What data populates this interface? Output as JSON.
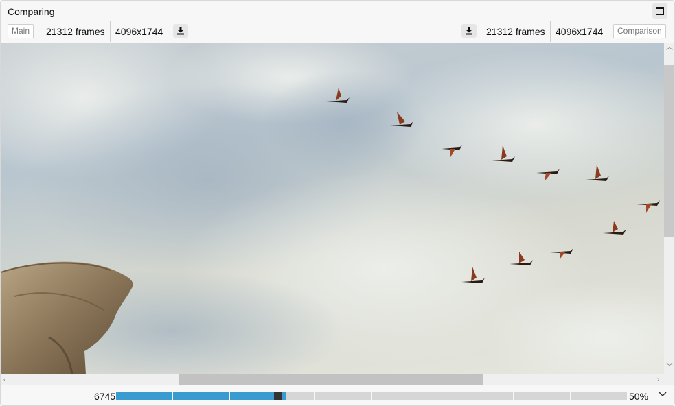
{
  "window": {
    "title": "Comparing",
    "maximize_icon": "maximize-icon"
  },
  "left_panel": {
    "tag_label": "Main",
    "frames": "21312 frames",
    "resolution": "4096x1744",
    "download_icon": "download-icon"
  },
  "right_panel": {
    "tag_label": "Comparison",
    "frames": "21312 frames",
    "resolution": "4096x1744",
    "download_icon": "download-icon"
  },
  "timeline": {
    "current_frame": "6745",
    "progress": 0.325,
    "segments_total": 18,
    "segments_loaded": 6,
    "colors": {
      "loaded": "#3a9bd0",
      "cursor": "#333333",
      "empty": "#d6d6d6"
    }
  },
  "zoom": {
    "value": "50%"
  }
}
